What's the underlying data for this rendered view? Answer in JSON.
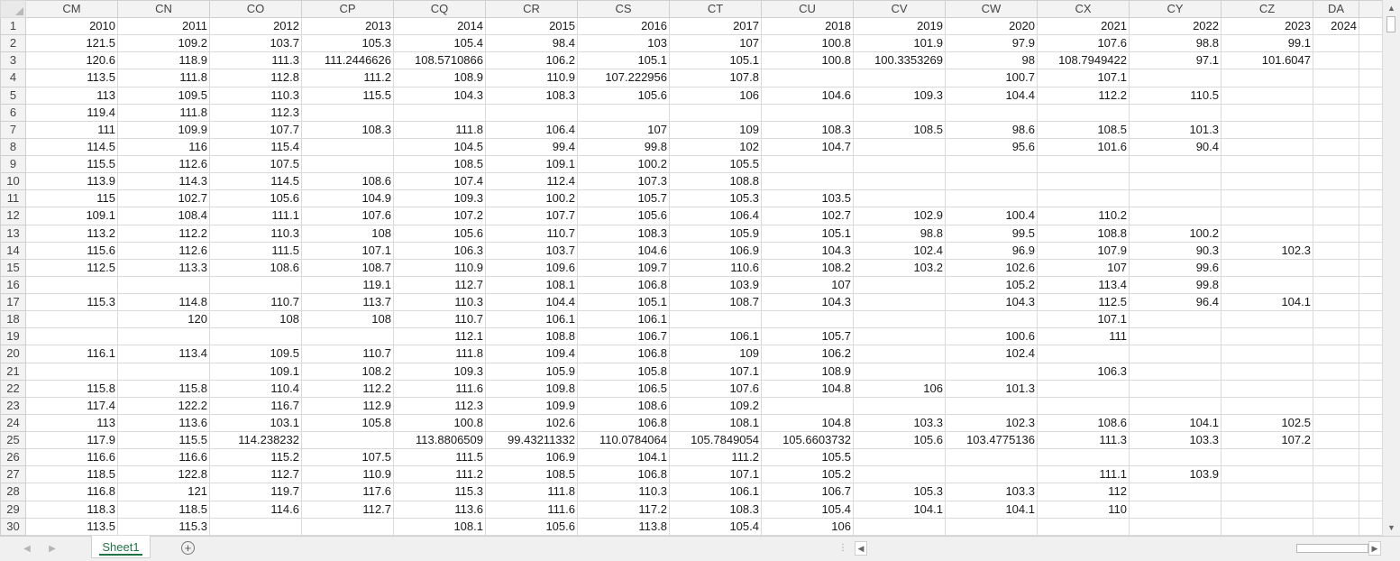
{
  "columns": [
    "CM",
    "CN",
    "CO",
    "CP",
    "CQ",
    "CR",
    "CS",
    "CT",
    "CU",
    "CV",
    "CW",
    "CX",
    "CY",
    "CZ",
    "DA"
  ],
  "rows": [
    {
      "num": "1",
      "cells": [
        "2010",
        "2011",
        "2012",
        "2013",
        "2014",
        "2015",
        "2016",
        "2017",
        "2018",
        "2019",
        "2020",
        "2021",
        "2022",
        "2023",
        "2024"
      ]
    },
    {
      "num": "2",
      "cells": [
        "121.5",
        "109.2",
        "103.7",
        "105.3",
        "105.4",
        "98.4",
        "103",
        "107",
        "100.8",
        "101.9",
        "97.9",
        "107.6",
        "98.8",
        "99.1",
        ""
      ]
    },
    {
      "num": "3",
      "cells": [
        "120.6",
        "118.9",
        "111.3",
        "111.2446626",
        "108.5710866",
        "106.2",
        "105.1",
        "105.1",
        "100.8",
        "100.3353269",
        "98",
        "108.7949422",
        "97.1",
        "101.6047",
        ""
      ]
    },
    {
      "num": "4",
      "cells": [
        "113.5",
        "111.8",
        "112.8",
        "111.2",
        "108.9",
        "110.9",
        "107.222956",
        "107.8",
        "",
        "",
        "100.7",
        "107.1",
        "",
        "",
        ""
      ]
    },
    {
      "num": "5",
      "cells": [
        "113",
        "109.5",
        "110.3",
        "115.5",
        "104.3",
        "108.3",
        "105.6",
        "106",
        "104.6",
        "109.3",
        "104.4",
        "112.2",
        "110.5",
        "",
        ""
      ]
    },
    {
      "num": "6",
      "cells": [
        "119.4",
        "111.8",
        "112.3",
        "",
        "",
        "",
        "",
        "",
        "",
        "",
        "",
        "",
        "",
        "",
        ""
      ]
    },
    {
      "num": "7",
      "cells": [
        "111",
        "109.9",
        "107.7",
        "108.3",
        "111.8",
        "106.4",
        "107",
        "109",
        "108.3",
        "108.5",
        "98.6",
        "108.5",
        "101.3",
        "",
        ""
      ]
    },
    {
      "num": "8",
      "cells": [
        "114.5",
        "116",
        "115.4",
        "",
        "104.5",
        "99.4",
        "99.8",
        "102",
        "104.7",
        "",
        "95.6",
        "101.6",
        "90.4",
        "",
        ""
      ]
    },
    {
      "num": "9",
      "cells": [
        "115.5",
        "112.6",
        "107.5",
        "",
        "108.5",
        "109.1",
        "100.2",
        "105.5",
        "",
        "",
        "",
        "",
        "",
        "",
        ""
      ]
    },
    {
      "num": "10",
      "cells": [
        "113.9",
        "114.3",
        "114.5",
        "108.6",
        "107.4",
        "112.4",
        "107.3",
        "108.8",
        "",
        "",
        "",
        "",
        "",
        "",
        ""
      ]
    },
    {
      "num": "11",
      "cells": [
        "115",
        "102.7",
        "105.6",
        "104.9",
        "109.3",
        "100.2",
        "105.7",
        "105.3",
        "103.5",
        "",
        "",
        "",
        "",
        "",
        ""
      ]
    },
    {
      "num": "12",
      "cells": [
        "109.1",
        "108.4",
        "111.1",
        "107.6",
        "107.2",
        "107.7",
        "105.6",
        "106.4",
        "102.7",
        "102.9",
        "100.4",
        "110.2",
        "",
        "",
        ""
      ]
    },
    {
      "num": "13",
      "cells": [
        "113.2",
        "112.2",
        "110.3",
        "108",
        "105.6",
        "110.7",
        "108.3",
        "105.9",
        "105.1",
        "98.8",
        "99.5",
        "108.8",
        "100.2",
        "",
        ""
      ]
    },
    {
      "num": "14",
      "cells": [
        "115.6",
        "112.6",
        "111.5",
        "107.1",
        "106.3",
        "103.7",
        "104.6",
        "106.9",
        "104.3",
        "102.4",
        "96.9",
        "107.9",
        "90.3",
        "102.3",
        ""
      ]
    },
    {
      "num": "15",
      "cells": [
        "112.5",
        "113.3",
        "108.6",
        "108.7",
        "110.9",
        "109.6",
        "109.7",
        "110.6",
        "108.2",
        "103.2",
        "102.6",
        "107",
        "99.6",
        "",
        ""
      ]
    },
    {
      "num": "16",
      "cells": [
        "",
        "",
        "",
        "119.1",
        "112.7",
        "108.1",
        "106.8",
        "103.9",
        "107",
        "",
        "105.2",
        "113.4",
        "99.8",
        "",
        ""
      ]
    },
    {
      "num": "17",
      "cells": [
        "115.3",
        "114.8",
        "110.7",
        "113.7",
        "110.3",
        "104.4",
        "105.1",
        "108.7",
        "104.3",
        "",
        "104.3",
        "112.5",
        "96.4",
        "104.1",
        ""
      ]
    },
    {
      "num": "18",
      "cells": [
        "",
        "120",
        "108",
        "108",
        "110.7",
        "106.1",
        "106.1",
        "",
        "",
        "",
        "",
        "107.1",
        "",
        "",
        ""
      ]
    },
    {
      "num": "19",
      "cells": [
        "",
        "",
        "",
        "",
        "112.1",
        "108.8",
        "106.7",
        "106.1",
        "105.7",
        "",
        "100.6",
        "111",
        "",
        "",
        ""
      ]
    },
    {
      "num": "20",
      "cells": [
        "116.1",
        "113.4",
        "109.5",
        "110.7",
        "111.8",
        "109.4",
        "106.8",
        "109",
        "106.2",
        "",
        "102.4",
        "",
        "",
        "",
        ""
      ]
    },
    {
      "num": "21",
      "cells": [
        "",
        "",
        "109.1",
        "108.2",
        "109.3",
        "105.9",
        "105.8",
        "107.1",
        "108.9",
        "",
        "",
        "106.3",
        "",
        "",
        ""
      ]
    },
    {
      "num": "22",
      "cells": [
        "115.8",
        "115.8",
        "110.4",
        "112.2",
        "111.6",
        "109.8",
        "106.5",
        "107.6",
        "104.8",
        "106",
        "101.3",
        "",
        "",
        "",
        ""
      ]
    },
    {
      "num": "23",
      "cells": [
        "117.4",
        "122.2",
        "116.7",
        "112.9",
        "112.3",
        "109.9",
        "108.6",
        "109.2",
        "",
        "",
        "",
        "",
        "",
        "",
        ""
      ]
    },
    {
      "num": "24",
      "cells": [
        "113",
        "113.6",
        "103.1",
        "105.8",
        "100.8",
        "102.6",
        "106.8",
        "108.1",
        "104.8",
        "103.3",
        "102.3",
        "108.6",
        "104.1",
        "102.5",
        ""
      ]
    },
    {
      "num": "25",
      "cells": [
        "117.9",
        "115.5",
        "114.238232",
        "",
        "113.8806509",
        "99.43211332",
        "110.0784064",
        "105.7849054",
        "105.6603732",
        "105.6",
        "103.4775136",
        "111.3",
        "103.3",
        "107.2",
        ""
      ]
    },
    {
      "num": "26",
      "cells": [
        "116.6",
        "116.6",
        "115.2",
        "107.5",
        "111.5",
        "106.9",
        "104.1",
        "111.2",
        "105.5",
        "",
        "",
        "",
        "",
        "",
        ""
      ]
    },
    {
      "num": "27",
      "cells": [
        "118.5",
        "122.8",
        "112.7",
        "110.9",
        "111.2",
        "108.5",
        "106.8",
        "107.1",
        "105.2",
        "",
        "",
        "111.1",
        "103.9",
        "",
        ""
      ]
    },
    {
      "num": "28",
      "cells": [
        "116.8",
        "121",
        "119.7",
        "117.6",
        "115.3",
        "111.8",
        "110.3",
        "106.1",
        "106.7",
        "105.3",
        "103.3",
        "112",
        "",
        "",
        ""
      ]
    },
    {
      "num": "29",
      "cells": [
        "118.3",
        "118.5",
        "114.6",
        "112.7",
        "113.6",
        "111.6",
        "117.2",
        "108.3",
        "105.4",
        "104.1",
        "104.1",
        "110",
        "",
        "",
        ""
      ]
    },
    {
      "num": "30",
      "cells": [
        "113.5",
        "115.3",
        "",
        "",
        "108.1",
        "105.6",
        "113.8",
        "105.4",
        "106",
        "",
        "",
        "",
        "",
        "",
        ""
      ]
    }
  ],
  "sheet_tab": {
    "label": "Sheet1"
  },
  "icons": {
    "add_sheet": "plus-circle-icon",
    "splitter": "vertical-dots-icon"
  },
  "colors": {
    "accent": "#217346"
  }
}
